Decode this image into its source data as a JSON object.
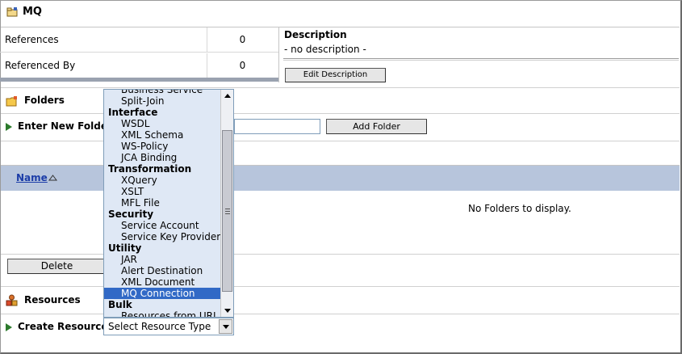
{
  "header": {
    "title": "MQ",
    "icon": "project-icon"
  },
  "references": [
    {
      "label": "References",
      "value": "0"
    },
    {
      "label": "Referenced By",
      "value": "0"
    }
  ],
  "description": {
    "heading": "Description",
    "text": "- no description -",
    "edit_label": "Edit Description"
  },
  "folders": {
    "title": "Folders",
    "new_folder_label": "Enter New Folder",
    "new_folder_value": "",
    "add_label": "Add Folder",
    "column_name": "Name",
    "empty_text": "No Folders to display.",
    "delete_label": "Delete"
  },
  "resources": {
    "title": "Resources",
    "create_label": "Create Resource:",
    "select_value": "Select Resource Type"
  },
  "dropdown": [
    {
      "label": "Business Service",
      "group": false
    },
    {
      "label": "Split-Join",
      "group": false
    },
    {
      "label": "Interface",
      "group": true
    },
    {
      "label": "WSDL",
      "group": false
    },
    {
      "label": "XML Schema",
      "group": false
    },
    {
      "label": "WS-Policy",
      "group": false
    },
    {
      "label": "JCA Binding",
      "group": false
    },
    {
      "label": "Transformation",
      "group": true
    },
    {
      "label": "XQuery",
      "group": false
    },
    {
      "label": "XSLT",
      "group": false
    },
    {
      "label": "MFL File",
      "group": false
    },
    {
      "label": "Security",
      "group": true
    },
    {
      "label": "Service Account",
      "group": false
    },
    {
      "label": "Service Key Provider",
      "group": false
    },
    {
      "label": "Utility",
      "group": true
    },
    {
      "label": "JAR",
      "group": false
    },
    {
      "label": "Alert Destination",
      "group": false
    },
    {
      "label": "XML Document",
      "group": false
    },
    {
      "label": "MQ Connection",
      "group": false,
      "selected": true
    },
    {
      "label": "Bulk",
      "group": true
    },
    {
      "label": "Resources from URL",
      "group": false
    }
  ],
  "colors": {
    "grid_header": "#b7c5dc",
    "dropdown_bg": "#dfe8f5",
    "selected": "#3169c6",
    "link": "#1c3da8"
  }
}
